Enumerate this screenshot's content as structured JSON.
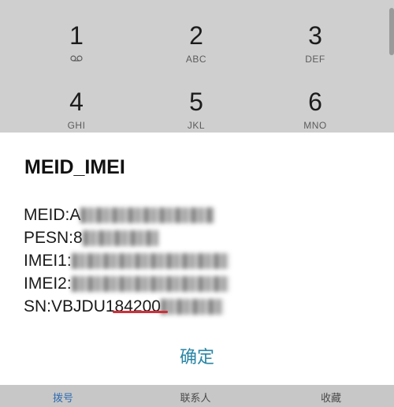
{
  "keypad": {
    "keys": [
      {
        "digit": "1",
        "letters": "",
        "icon": "voicemail-icon"
      },
      {
        "digit": "2",
        "letters": "ABC"
      },
      {
        "digit": "3",
        "letters": "DEF"
      },
      {
        "digit": "4",
        "letters": "GHI"
      },
      {
        "digit": "5",
        "letters": "JKL"
      },
      {
        "digit": "6",
        "letters": "MNO"
      }
    ]
  },
  "dialog": {
    "title": "MEID_IMEI",
    "lines": [
      {
        "label": "MEID:",
        "value": "A"
      },
      {
        "label": "PESN:",
        "value": "8"
      },
      {
        "label": "IMEI1:",
        "value": ""
      },
      {
        "label": "IMEI2:",
        "value": ""
      },
      {
        "label": "SN:",
        "value": "VBJDU184200"
      }
    ],
    "ok_label": "确定"
  },
  "tabs": {
    "dial": "拨号",
    "contacts": "联系人",
    "favorites": "收藏"
  },
  "colors": {
    "accent": "#2a86a6",
    "highlight_underline": "#d0303a"
  }
}
